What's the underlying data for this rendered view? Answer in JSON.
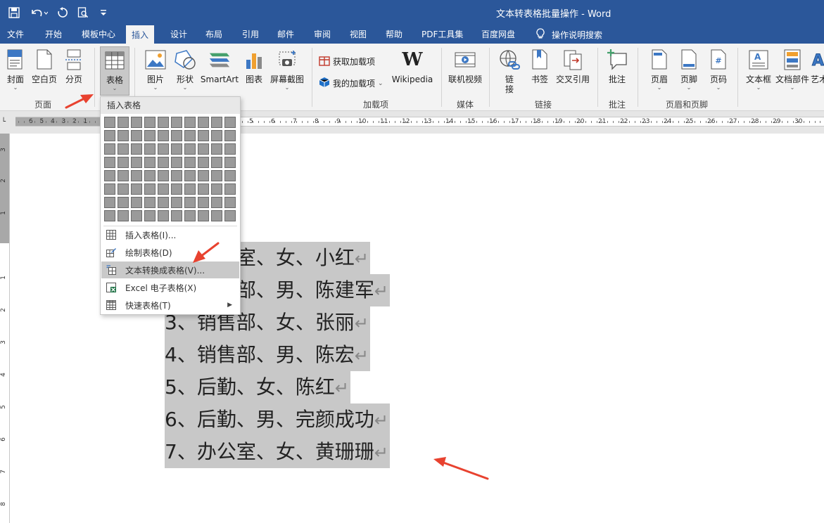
{
  "window": {
    "title": "文本转表格批量操作  -  Word"
  },
  "quick_access": [
    "save-icon",
    "undo-icon",
    "redo-icon",
    "print-preview-icon",
    "customize-icon"
  ],
  "tabs": [
    {
      "label": "文件"
    },
    {
      "label": "开始"
    },
    {
      "label": "模板中心"
    },
    {
      "label": "插入"
    },
    {
      "label": "设计"
    },
    {
      "label": "布局"
    },
    {
      "label": "引用"
    },
    {
      "label": "邮件"
    },
    {
      "label": "审阅"
    },
    {
      "label": "视图"
    },
    {
      "label": "帮助"
    },
    {
      "label": "PDF工具集"
    },
    {
      "label": "百度网盘"
    }
  ],
  "tell_me": {
    "label": "操作说明搜索"
  },
  "ribbon": {
    "buttons": {
      "cover": "封面",
      "blank_page": "空白页",
      "page_break": "分页",
      "table": "表格",
      "picture": "图片",
      "shape": "形状",
      "smartart": "SmartArt",
      "chart": "图表",
      "screenshot": "屏幕截图",
      "get_addins": "获取加载项",
      "my_addins": "我的加载项",
      "wikipedia": "Wikipedia",
      "online_video": "联机视频",
      "link": "链\n接",
      "bookmark": "书签",
      "cross_ref": "交叉引用",
      "comment": "批注",
      "header": "页眉",
      "footer": "页脚",
      "page_num": "页码",
      "textbox": "文本框",
      "doc_parts": "文档部件",
      "wordart": "艺术"
    },
    "groups": {
      "pages": "页面",
      "addins": "加载项",
      "media": "媒体",
      "links": "链接",
      "comments": "批注",
      "header_footer": "页眉和页脚"
    }
  },
  "ruler_numbers": [
    "6",
    "5",
    "4",
    "3",
    "2",
    "1",
    "1",
    "2",
    "3",
    "4",
    "5",
    "6",
    "7",
    "8",
    "9",
    "10",
    "11",
    "12",
    "13",
    "14",
    "15",
    "16",
    "17",
    "18",
    "19",
    "20",
    "21",
    "22",
    "23",
    "24",
    "25",
    "26",
    "27",
    "28",
    "29",
    "30"
  ],
  "vruler_numbers": [
    "3",
    "2",
    "1",
    "1",
    "2",
    "3",
    "4",
    "5",
    "6",
    "7",
    "8"
  ],
  "dropdown": {
    "header": "插入表格",
    "items": [
      {
        "label": "插入表格(I)..."
      },
      {
        "label": "绘制表格(D)"
      },
      {
        "label": "文本转换成表格(V)..."
      },
      {
        "label": "Excel 电子表格(X)"
      },
      {
        "label": "快速表格(T)"
      }
    ]
  },
  "document": {
    "lines": [
      {
        "text": "1、办公室、女、小红"
      },
      {
        "text": "2、销售部、男、陈建军"
      },
      {
        "text": "3、销售部、女、张丽"
      },
      {
        "text": "4、销售部、男、陈宏"
      },
      {
        "text": "5、后勤、女、陈红"
      },
      {
        "text": "6、后勤、男、完颜成功"
      },
      {
        "text": "7、办公室、女、黄珊珊"
      }
    ],
    "paragraph_mark": "↵"
  },
  "colors": {
    "accent": "#2b579a",
    "selection": "#c8c8c8",
    "annotation_arrow": "#e8422f"
  }
}
